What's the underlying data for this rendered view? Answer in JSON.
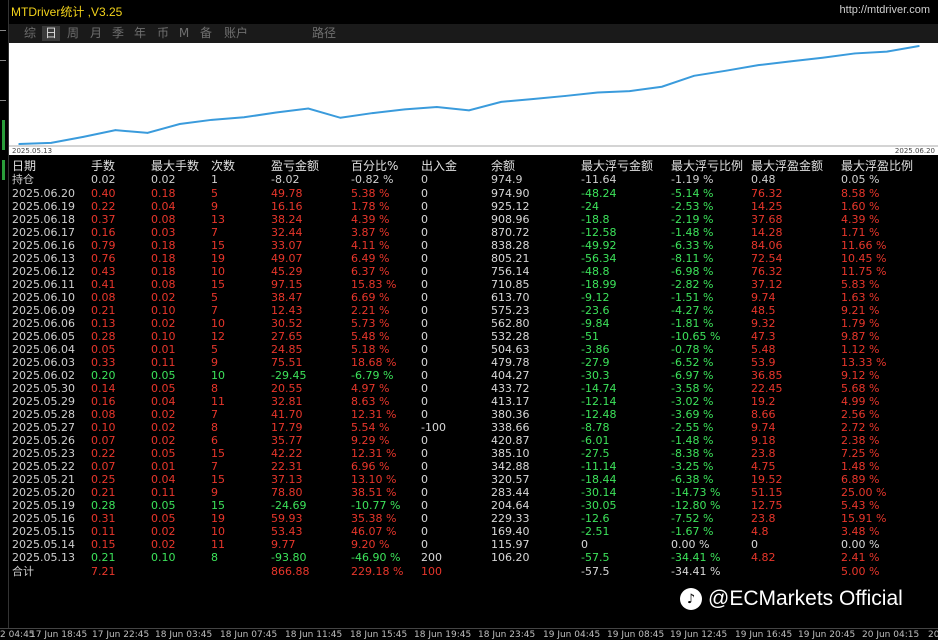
{
  "window": {
    "title": "MTDriver统计 ,V3.25",
    "url": "http://mtdriver.com"
  },
  "tabs": [
    {
      "label": "综",
      "active": false
    },
    {
      "label": "日",
      "active": true
    },
    {
      "label": "周",
      "active": false
    },
    {
      "label": "月",
      "active": false
    },
    {
      "label": "季",
      "active": false
    },
    {
      "label": "年",
      "active": false
    },
    {
      "label": "币",
      "active": false
    },
    {
      "label": "M",
      "active": false
    },
    {
      "label": "备",
      "active": false
    },
    {
      "label": "账户",
      "active": false
    },
    {
      "label": "路径",
      "active": false
    }
  ],
  "chart_data": {
    "type": "line",
    "x_start_label": "2025.05.13",
    "x_end_label": "2025.06.20",
    "x": [
      "2025.05.13",
      "2025.05.14",
      "2025.05.15",
      "2025.05.16",
      "2025.05.19",
      "2025.05.20",
      "2025.05.21",
      "2025.05.22",
      "2025.05.23",
      "2025.05.26",
      "2025.05.27",
      "2025.05.28",
      "2025.05.29",
      "2025.05.30",
      "2025.06.02",
      "2025.06.03",
      "2025.06.04",
      "2025.06.05",
      "2025.06.06",
      "2025.06.09",
      "2025.06.10",
      "2025.06.11",
      "2025.06.12",
      "2025.06.13",
      "2025.06.16",
      "2025.06.17",
      "2025.06.18",
      "2025.06.19",
      "2025.06.20"
    ],
    "y": [
      106.2,
      115.97,
      169.4,
      229.33,
      204.64,
      283.44,
      320.57,
      342.88,
      385.1,
      420.87,
      338.66,
      380.36,
      413.17,
      433.72,
      404.27,
      479.78,
      504.63,
      532.28,
      562.8,
      575.23,
      613.7,
      710.85,
      756.14,
      805.21,
      838.28,
      870.72,
      908.96,
      925.12,
      974.9
    ],
    "color": "#3a9bdc",
    "grid": false
  },
  "table": {
    "headers": [
      "日期",
      "手数",
      "最大手数",
      "次数",
      "盈亏金额",
      "百分比%",
      "出入金",
      "余额",
      "最大浮亏金额",
      "最大浮亏比例",
      "最大浮盈金额",
      "最大浮盈比例"
    ],
    "position_row": [
      "持仓",
      "0.02",
      "0.02",
      "1",
      "-8.02",
      "-0.82 %",
      "0",
      "974.9",
      "-11.64",
      "-1.19 %",
      "0.48",
      "0.05 %"
    ],
    "rows": [
      [
        "2025.06.20",
        "0.40",
        "0.18",
        "5",
        "49.78",
        "5.38 %",
        "0",
        "974.90",
        "-48.24",
        "-5.14 %",
        "76.32",
        "8.58 %"
      ],
      [
        "2025.06.19",
        "0.22",
        "0.04",
        "9",
        "16.16",
        "1.78 %",
        "0",
        "925.12",
        "-24",
        "-2.53 %",
        "14.25",
        "1.60 %"
      ],
      [
        "2025.06.18",
        "0.37",
        "0.08",
        "13",
        "38.24",
        "4.39 %",
        "0",
        "908.96",
        "-18.8",
        "-2.19 %",
        "37.68",
        "4.39 %"
      ],
      [
        "2025.06.17",
        "0.16",
        "0.03",
        "7",
        "32.44",
        "3.87 %",
        "0",
        "870.72",
        "-12.58",
        "-1.48 %",
        "14.28",
        "1.71 %"
      ],
      [
        "2025.06.16",
        "0.79",
        "0.18",
        "15",
        "33.07",
        "4.11 %",
        "0",
        "838.28",
        "-49.92",
        "-6.33 %",
        "84.06",
        "11.66 %"
      ],
      [
        "2025.06.13",
        "0.76",
        "0.18",
        "19",
        "49.07",
        "6.49 %",
        "0",
        "805.21",
        "-56.34",
        "-8.11 %",
        "72.54",
        "10.45 %"
      ],
      [
        "2025.06.12",
        "0.43",
        "0.18",
        "10",
        "45.29",
        "6.37 %",
        "0",
        "756.14",
        "-48.8",
        "-6.98 %",
        "76.32",
        "11.75 %"
      ],
      [
        "2025.06.11",
        "0.41",
        "0.08",
        "15",
        "97.15",
        "15.83 %",
        "0",
        "710.85",
        "-18.99",
        "-2.82 %",
        "37.12",
        "5.83 %"
      ],
      [
        "2025.06.10",
        "0.08",
        "0.02",
        "5",
        "38.47",
        "6.69 %",
        "0",
        "613.70",
        "-9.12",
        "-1.51 %",
        "9.74",
        "1.63 %"
      ],
      [
        "2025.06.09",
        "0.21",
        "0.10",
        "7",
        "12.43",
        "2.21 %",
        "0",
        "575.23",
        "-23.6",
        "-4.27 %",
        "48.5",
        "9.21 %"
      ],
      [
        "2025.06.06",
        "0.13",
        "0.02",
        "10",
        "30.52",
        "5.73 %",
        "0",
        "562.80",
        "-9.84",
        "-1.81 %",
        "9.32",
        "1.79 %"
      ],
      [
        "2025.06.05",
        "0.28",
        "0.10",
        "12",
        "27.65",
        "5.48 %",
        "0",
        "532.28",
        "-51",
        "-10.65 %",
        "47.3",
        "9.87 %"
      ],
      [
        "2025.06.04",
        "0.05",
        "0.01",
        "5",
        "24.85",
        "5.18 %",
        "0",
        "504.63",
        "-3.86",
        "-0.78 %",
        "5.48",
        "1.12 %"
      ],
      [
        "2025.06.03",
        "0.33",
        "0.11",
        "9",
        "75.51",
        "18.68 %",
        "0",
        "479.78",
        "-27.9",
        "-6.52 %",
        "53.9",
        "13.33 %"
      ],
      [
        "2025.06.02",
        "0.20",
        "0.05",
        "10",
        "-29.45",
        "-6.79 %",
        "0",
        "404.27",
        "-30.3",
        "-6.97 %",
        "36.85",
        "9.12 %"
      ],
      [
        "2025.05.30",
        "0.14",
        "0.05",
        "8",
        "20.55",
        "4.97 %",
        "0",
        "433.72",
        "-14.74",
        "-3.58 %",
        "22.45",
        "5.68 %"
      ],
      [
        "2025.05.29",
        "0.16",
        "0.04",
        "11",
        "32.81",
        "8.63 %",
        "0",
        "413.17",
        "-12.14",
        "-3.02 %",
        "19.2",
        "4.99 %"
      ],
      [
        "2025.05.28",
        "0.08",
        "0.02",
        "7",
        "41.70",
        "12.31 %",
        "0",
        "380.36",
        "-12.48",
        "-3.69 %",
        "8.66",
        "2.56 %"
      ],
      [
        "2025.05.27",
        "0.10",
        "0.02",
        "8",
        "17.79",
        "5.54 %",
        "-100",
        "338.66",
        "-8.78",
        "-2.55 %",
        "9.74",
        "2.72 %"
      ],
      [
        "2025.05.26",
        "0.07",
        "0.02",
        "6",
        "35.77",
        "9.29 %",
        "0",
        "420.87",
        "-6.01",
        "-1.48 %",
        "9.18",
        "2.38 %"
      ],
      [
        "2025.05.23",
        "0.22",
        "0.05",
        "15",
        "42.22",
        "12.31 %",
        "0",
        "385.10",
        "-27.5",
        "-8.38 %",
        "23.8",
        "7.25 %"
      ],
      [
        "2025.05.22",
        "0.07",
        "0.01",
        "7",
        "22.31",
        "6.96 %",
        "0",
        "342.88",
        "-11.14",
        "-3.25 %",
        "4.75",
        "1.48 %"
      ],
      [
        "2025.05.21",
        "0.25",
        "0.04",
        "15",
        "37.13",
        "13.10 %",
        "0",
        "320.57",
        "-18.44",
        "-6.38 %",
        "19.52",
        "6.89 %"
      ],
      [
        "2025.05.20",
        "0.21",
        "0.11",
        "9",
        "78.80",
        "38.51 %",
        "0",
        "283.44",
        "-30.14",
        "-14.73 %",
        "51.15",
        "25.00 %"
      ],
      [
        "2025.05.19",
        "0.28",
        "0.05",
        "15",
        "-24.69",
        "-10.77 %",
        "0",
        "204.64",
        "-30.05",
        "-12.80 %",
        "12.75",
        "5.43 %"
      ],
      [
        "2025.05.16",
        "0.31",
        "0.05",
        "19",
        "59.93",
        "35.38 %",
        "0",
        "229.33",
        "-12.6",
        "-7.52 %",
        "23.8",
        "15.91 %"
      ],
      [
        "2025.05.15",
        "0.11",
        "0.02",
        "10",
        "53.43",
        "46.07 %",
        "0",
        "169.40",
        "-2.51",
        "-1.67 %",
        "4.8",
        "3.48 %"
      ],
      [
        "2025.05.14",
        "0.15",
        "0.02",
        "11",
        "9.77",
        "9.20 %",
        "0",
        "115.97",
        "0",
        "0.00 %",
        "0",
        "0.00 %"
      ],
      [
        "2025.05.13",
        "0.21",
        "0.10",
        "8",
        "-93.80",
        "-46.90 %",
        "200",
        "106.20",
        "-57.5",
        "-34.41 %",
        "4.82",
        "2.41 %"
      ]
    ],
    "total_row": [
      "合计",
      "7.21",
      "",
      "",
      "866.88",
      "229.18 %",
      "100",
      "",
      "-57.5",
      "-34.41 %",
      "",
      "5.00 %"
    ]
  },
  "bottom_axis": [
    "2 04:45",
    "17 Jun 18:45",
    "17 Jun 22:45",
    "18 Jun 03:45",
    "18 Jun 07:45",
    "18 Jun 11:45",
    "18 Jun 15:45",
    "18 Jun 19:45",
    "18 Jun 23:45",
    "19 Jun 04:45",
    "19 Jun 08:45",
    "19 Jun 12:45",
    "19 Jun 16:45",
    "19 Jun 20:45",
    "20 Jun 04:15",
    "20"
  ],
  "watermark": {
    "text": "@ECMarkets Official",
    "icon": "tiktok-icon"
  },
  "colors": {
    "profit": "#e8362b",
    "loss": "#3ce25a",
    "neutral": "#d8d8d8",
    "title": "#f2d21b",
    "line": "#3a9bdc"
  }
}
